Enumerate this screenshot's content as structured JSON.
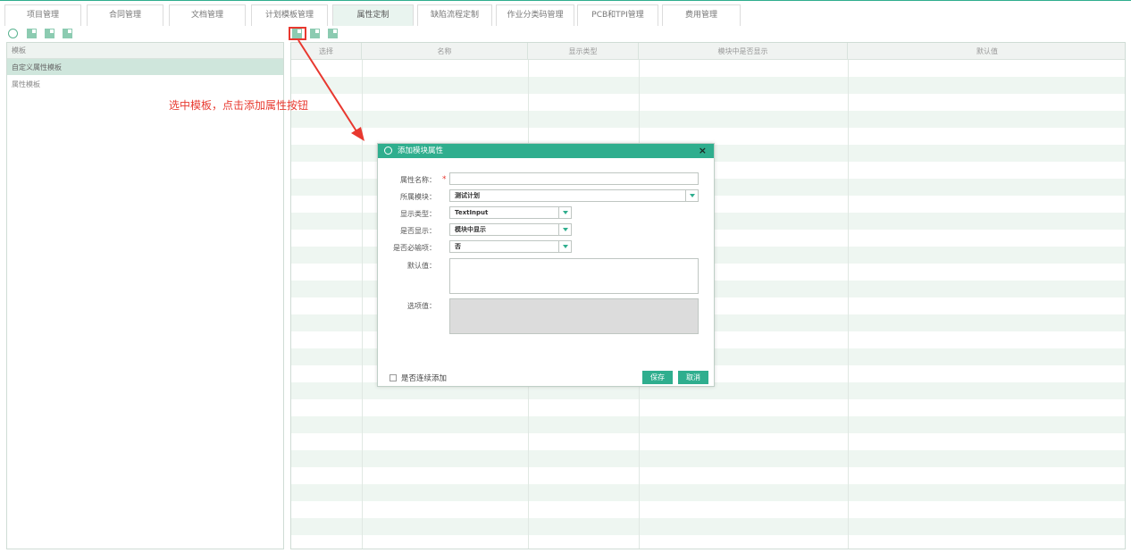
{
  "tabs": [
    {
      "label": "项目管理",
      "active": false
    },
    {
      "label": "合同管理",
      "active": false
    },
    {
      "label": "文档管理",
      "active": false
    },
    {
      "label": "计划模板管理",
      "active": false
    },
    {
      "label": "属性定制",
      "active": true
    },
    {
      "label": "缺陷流程定制",
      "active": false
    },
    {
      "label": "作业分类码管理",
      "active": false
    },
    {
      "label": "PCB和TPI管理",
      "active": false
    },
    {
      "label": "费用管理",
      "active": false
    }
  ],
  "left_panel": {
    "header": "模板",
    "items": [
      {
        "label": "自定义属性模板",
        "selected": true
      },
      {
        "label": "属性模板",
        "selected": false
      }
    ]
  },
  "grid": {
    "columns": [
      "选择",
      "名称",
      "显示类型",
      "模块中是否显示",
      "默认值"
    ]
  },
  "annotation": "选中模板，点击添加属性按钮",
  "dialog": {
    "title": "添加模块属性",
    "close": "×",
    "fields": {
      "name_label": "属性名称：",
      "name_required": "*",
      "name_value": "",
      "module_label": "所属模块：",
      "module_value": "测试计划",
      "display_type_label": "显示类型：",
      "display_type_value": "TextInput",
      "show_label": "是否显示：",
      "show_value": "模块中显示",
      "required_label": "是否必输项：",
      "required_value": "否",
      "default_label": "默认值：",
      "options_label": "选项值："
    },
    "continuous_add_label": "是否连续添加",
    "save_label": "保存",
    "cancel_label": "取消"
  },
  "colors": {
    "accent": "#2fae8e",
    "annotation": "#e8382f"
  }
}
